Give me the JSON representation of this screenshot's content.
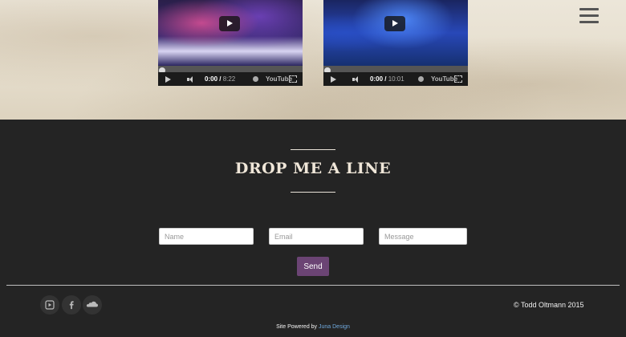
{
  "videos": [
    {
      "current_time": "0:00",
      "duration": "8:22",
      "logo": "YouTube"
    },
    {
      "current_time": "0:00",
      "duration": "10:01",
      "logo": "YouTube"
    }
  ],
  "contact": {
    "heading": "DROP ME A LINE",
    "name_placeholder": "Name",
    "email_placeholder": "Email",
    "message_placeholder": "Message",
    "send_label": "Send"
  },
  "footer": {
    "copyright": "© Todd Oltmann 2015",
    "powered_prefix": "Site Powered by ",
    "powered_link": "Juna Design",
    "social_icons": [
      "youtube-icon",
      "facebook-icon",
      "soundcloud-icon"
    ]
  },
  "colors": {
    "dark_bg": "#242424",
    "accent_button": "#6b4474",
    "link": "#6fa8dc",
    "heading_text": "#efe6d8"
  }
}
